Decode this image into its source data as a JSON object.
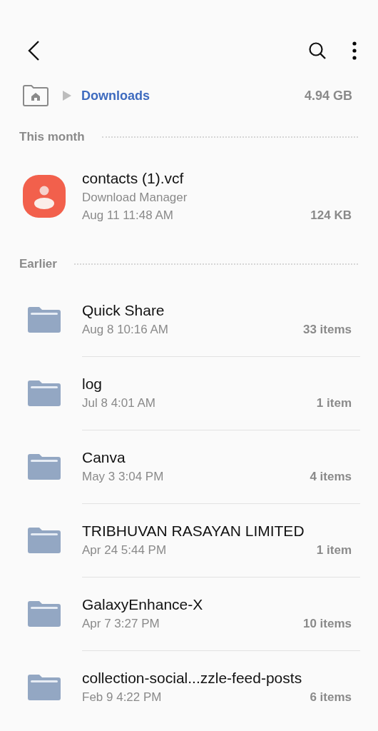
{
  "breadcrumb": {
    "folder": "Downloads",
    "size": "4.94 GB"
  },
  "sections": [
    {
      "title": "This month",
      "items": [
        {
          "kind": "file",
          "name": "contacts (1).vcf",
          "source": "Download Manager",
          "date": "Aug 11 11:48 AM",
          "size": "124 KB"
        }
      ]
    },
    {
      "title": "Earlier",
      "items": [
        {
          "kind": "folder",
          "name": "Quick Share",
          "date": "Aug 8 10:16 AM",
          "size": "33 items"
        },
        {
          "kind": "folder",
          "name": "log",
          "date": "Jul 8 4:01 AM",
          "size": "1 item"
        },
        {
          "kind": "folder",
          "name": "Canva",
          "date": "May 3 3:04 PM",
          "size": "4 items"
        },
        {
          "kind": "folder",
          "name": "TRIBHUVAN RASAYAN LIMITED",
          "date": "Apr 24 5:44 PM",
          "size": "1 item"
        },
        {
          "kind": "folder",
          "name": "GalaxyEnhance-X",
          "date": "Apr 7 3:27 PM",
          "size": "10 items"
        },
        {
          "kind": "folder",
          "name": "collection-social...zzle-feed-posts",
          "date": "Feb 9 4:22 PM",
          "size": "6 items"
        }
      ]
    }
  ]
}
